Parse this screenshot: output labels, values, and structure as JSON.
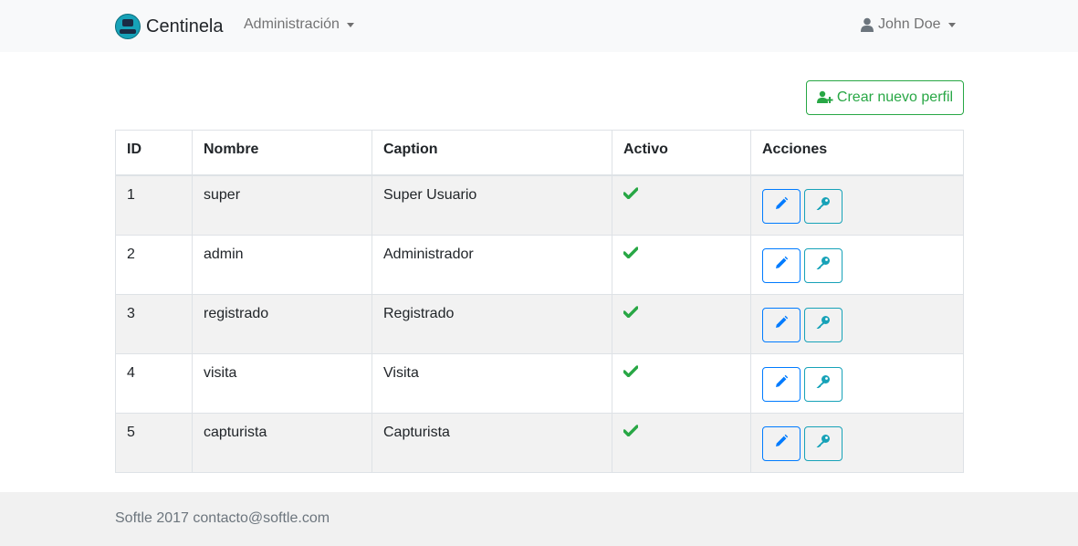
{
  "navbar": {
    "brand": "Centinela",
    "admin_menu": "Administración",
    "user_menu": "John Doe"
  },
  "actions": {
    "create_label": "Crear nuevo perfil"
  },
  "table": {
    "headers": [
      "ID",
      "Nombre",
      "Caption",
      "Activo",
      "Acciones"
    ],
    "rows": [
      {
        "id": "1",
        "nombre": "super",
        "caption": "Super Usuario",
        "activo": true
      },
      {
        "id": "2",
        "nombre": "admin",
        "caption": "Administrador",
        "activo": true
      },
      {
        "id": "3",
        "nombre": "registrado",
        "caption": "Registrado",
        "activo": true
      },
      {
        "id": "4",
        "nombre": "visita",
        "caption": "Visita",
        "activo": true
      },
      {
        "id": "5",
        "nombre": "capturista",
        "caption": "Capturista",
        "activo": true
      }
    ]
  },
  "footer": {
    "text": "Softle 2017 contacto@softle.com"
  },
  "colors": {
    "success": "#28a745",
    "primary": "#007bff",
    "info": "#17a2b8"
  },
  "icons": {
    "brand": "centinela-logo",
    "user": "user-icon",
    "create": "users-plus-icon",
    "active": "check-icon",
    "edit": "pencil-icon",
    "permissions": "key-icon"
  }
}
